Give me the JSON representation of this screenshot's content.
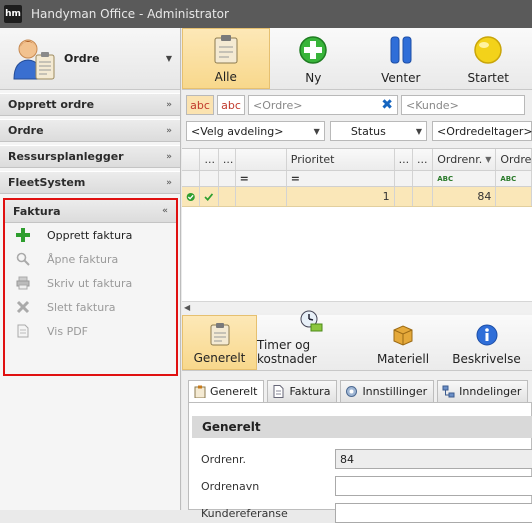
{
  "window": {
    "app_icon_text": "hm",
    "title": "Handyman Office - Administrator"
  },
  "sidebar": {
    "module": {
      "label": "Ordre",
      "icon": "user-clipboard-icon"
    },
    "groups": [
      {
        "label": "Opprett ordre",
        "chevron": "»"
      },
      {
        "label": "Ordre",
        "chevron": "»"
      },
      {
        "label": "Ressursplanlegger",
        "chevron": "»"
      },
      {
        "label": "FleetSystem",
        "chevron": "»"
      }
    ],
    "faktura": {
      "label": "Faktura",
      "chevron": "«",
      "items": [
        {
          "label": "Opprett faktura",
          "icon": "plus-icon",
          "enabled": true
        },
        {
          "label": "Åpne faktura",
          "icon": "magnifier-icon",
          "enabled": false
        },
        {
          "label": "Skriv ut faktura",
          "icon": "printer-icon",
          "enabled": false
        },
        {
          "label": "Slett faktura",
          "icon": "delete-x-icon",
          "enabled": false
        },
        {
          "label": "Vis PDF",
          "icon": "pdf-document-icon",
          "enabled": false
        }
      ]
    }
  },
  "toolbar": {
    "buttons": [
      {
        "label": "Alle",
        "icon": "clipboard-icon",
        "active": true
      },
      {
        "label": "Ny",
        "icon": "green-plus-circle-icon",
        "active": false
      },
      {
        "label": "Venter",
        "icon": "pause-icon",
        "active": false
      },
      {
        "label": "Startet",
        "icon": "yellow-circle-icon",
        "active": false
      }
    ]
  },
  "filters": {
    "abc1": "abc",
    "abc2": "abc",
    "ordre_placeholder": "<Ordre>",
    "kunde_placeholder": "<Kunde>",
    "avdeling": "<Velg avdeling>",
    "status": "Status",
    "ordredeltager": "<Ordredeltager>"
  },
  "grid": {
    "headers": [
      "",
      "...",
      "...",
      "",
      "Prioritet",
      "...",
      "...",
      "Ordrenr.",
      "Ordre"
    ],
    "filter_eq": "=",
    "filter_abc": "ABC",
    "row": {
      "prioritet": "1",
      "ordrenr": "84"
    }
  },
  "detail_tabs": [
    {
      "label": "Generelt",
      "icon": "clipboard-icon",
      "active": true
    },
    {
      "label": "Timer og kostnader",
      "icon": "clock-money-icon",
      "active": false
    },
    {
      "label": "Materiell",
      "icon": "box-icon",
      "active": false
    },
    {
      "label": "Beskrivelse",
      "icon": "info-icon",
      "active": false
    }
  ],
  "sub_tabs": [
    {
      "label": "Generelt",
      "active": true
    },
    {
      "label": "Faktura",
      "active": false
    },
    {
      "label": "Innstillinger",
      "active": false
    },
    {
      "label": "Inndelinger",
      "active": false
    }
  ],
  "form": {
    "section_title": "Generelt",
    "fields": [
      {
        "label": "Ordrenr.",
        "value": "84"
      },
      {
        "label": "Ordrenavn",
        "value": ""
      },
      {
        "label": "Kundereferanse",
        "value": ""
      }
    ]
  },
  "colors": {
    "active_tab": "#f8d88c",
    "highlight_border": "#e01010",
    "selected_row": "#fae7b8"
  }
}
